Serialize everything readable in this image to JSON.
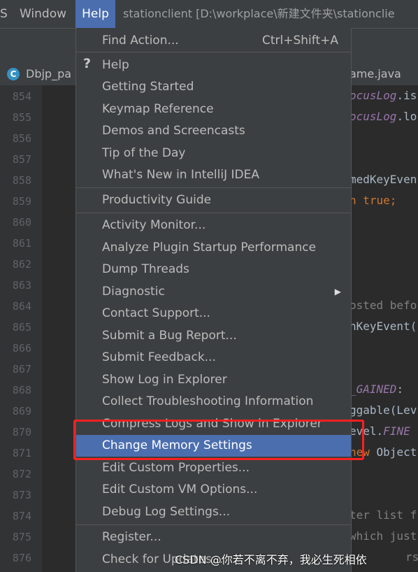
{
  "menubar": {
    "items": [
      "S",
      "Window",
      "Help"
    ],
    "title": "stationclient [D:\\workplace\\新建文件夹\\stationclie"
  },
  "tabs": {
    "left": "Dbjp_pa",
    "left_icon": "C",
    "right": "ame.java"
  },
  "gutter": {
    "lines": [
      "854",
      "855",
      "856",
      "857",
      "858",
      "859",
      "860",
      "861",
      "862",
      "863",
      "864",
      "865",
      "866",
      "867",
      "868",
      "869",
      "870",
      "871",
      "872",
      "873",
      "874",
      "875",
      "876"
    ]
  },
  "code": {
    "l854a": "ocusLog",
    "l854b": ".is",
    "l855a": "ocusLog",
    "l855b": ".lo",
    "l858": "medKeyEven",
    "l859a": "n ",
    "l859b": "true;",
    "l864": "osted befo",
    "l865": "nKeyEvent(",
    "l868a": "_GAINED",
    "l868b": ":",
    "l869": "ggable(Lev",
    "l870a": "evel.",
    "l870b": "FINE",
    "l871a": "new",
    "l871b": " Object",
    "l874": "ter list f",
    "l875": "which just",
    "l876": "rs"
  },
  "menu": {
    "find_action": "Find Action...",
    "find_action_shortcut": "Ctrl+Shift+A",
    "help_icon": "?",
    "help": "Help",
    "getting_started": "Getting Started",
    "keymap_reference": "Keymap Reference",
    "demos": "Demos and Screencasts",
    "tip": "Tip of the Day",
    "whats_new": "What's New in IntelliJ IDEA",
    "productivity": "Productivity Guide",
    "activity_monitor": "Activity Monitor...",
    "analyze_plugin": "Analyze Plugin Startup Performance",
    "dump_threads": "Dump Threads",
    "diagnostic": "Diagnostic",
    "contact_support": "Contact Support...",
    "submit_bug": "Submit a Bug Report...",
    "submit_feedback": "Submit Feedback...",
    "show_log": "Show Log in Explorer",
    "collect_troubleshooting": "Collect Troubleshooting Information",
    "compress_logs": "Compress Logs and Show in Explorer",
    "change_memory": "Change Memory Settings",
    "edit_custom_props": "Edit Custom Properties...",
    "edit_custom_vm": "Edit Custom VM Options...",
    "debug_log": "Debug Log Settings...",
    "register": "Register...",
    "check_updates": "Check for Updates..."
  },
  "watermark": "CSDN @你若不离不弃，我必生死相依",
  "colors": {
    "menu_bg": "#3c3f41",
    "selection": "#4b6eaf",
    "highlight_box": "#ff2020"
  }
}
